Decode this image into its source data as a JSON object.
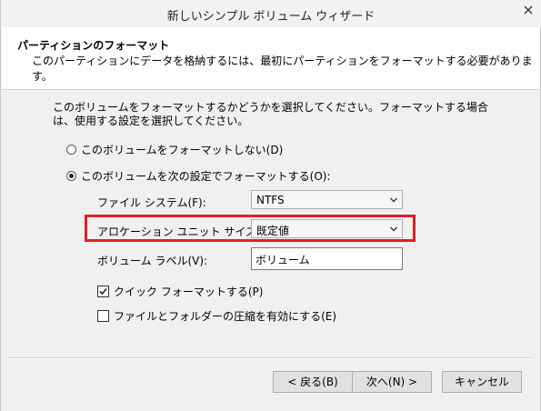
{
  "window": {
    "title": "新しいシンプル ボリューム ウィザード"
  },
  "header": {
    "title": "パーティションのフォーマット",
    "subtitle": "このパーティションにデータを格納するには、最初にパーティションをフォーマットする必要があります。"
  },
  "body": {
    "instruction": "このボリュームをフォーマットするかどうかを選択してください。フォーマットする場合は、使用する設定を選択してください。"
  },
  "options": {
    "no_format_label": "このボリュームをフォーマットしない(D)",
    "format_label": "このボリュームを次の設定でフォーマットする(O):",
    "selected": "format"
  },
  "settings": {
    "filesystem_label": "ファイル システム(F):",
    "filesystem_value": "NTFS",
    "allocation_label": "アロケーション ユニット サイズ(A):",
    "allocation_value": "既定値",
    "volume_label_label": "ボリューム ラベル(V):",
    "volume_label_value": "ボリューム",
    "quick_format_label": "クイック フォーマットする(P)",
    "quick_format_checked": true,
    "compression_label": "ファイルとフォルダーの圧縮を有効にする(E)",
    "compression_checked": false
  },
  "buttons": {
    "back": "< 戻る(B)",
    "next": "次へ(N) >",
    "cancel": "キャンセル"
  },
  "colors": {
    "highlight": "#e31e26"
  }
}
